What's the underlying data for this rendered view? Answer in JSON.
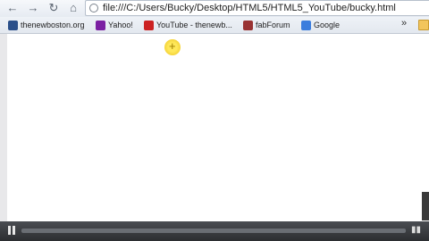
{
  "browser": {
    "url": "file:///C:/Users/Bucky/Desktop/HTML5/HTML5_YouTube/bucky.html"
  },
  "bookmarks": [
    {
      "label": "thenewboston.org",
      "icon": "nb-icon",
      "color": "#2a4f8a"
    },
    {
      "label": "Yahoo!",
      "icon": "yahoo-icon",
      "color": "#7b1fa2"
    },
    {
      "label": "YouTube - thenewb...",
      "icon": "youtube-icon",
      "color": "#cc2222"
    },
    {
      "label": "fabForum",
      "icon": "fab-icon",
      "color": "#993333"
    },
    {
      "label": "Google",
      "icon": "google-icon",
      "color": "#3b7ddd"
    }
  ],
  "video": {
    "progress": 0.0
  },
  "colors": {
    "controls_bg": "#2c2e31",
    "cursor_highlight": "#ffe85a"
  }
}
